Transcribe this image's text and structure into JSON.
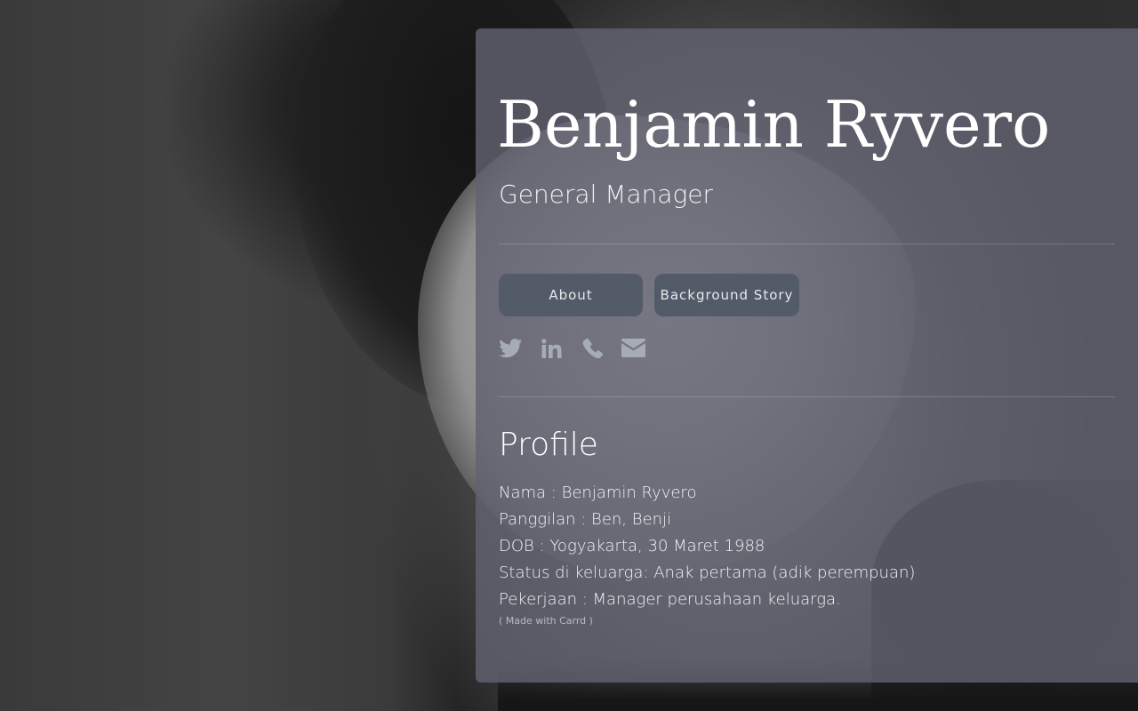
{
  "profile_card": {
    "name": "Benjamin Ryvero",
    "job_title": "General Manager",
    "buttons": {
      "about": "About",
      "background_story": "Background Story"
    },
    "social_icons": [
      "twitter-icon",
      "linkedin-icon",
      "phone-icon",
      "envelope-icon"
    ],
    "section_heading": "Profile",
    "details": [
      "Nama : Benjamin Ryvero",
      "Panggilan : Ben, Benji",
      "DOB : Yogyakarta, 30 Maret 1988",
      "Status di keluarga: Anak pertama (adik perempuan)",
      "Pekerjaan : Manager perusahaan keluarga."
    ],
    "footer_note": "( Made with Carrd )"
  },
  "colors": {
    "card_background": "#606270",
    "button_background": "#535a68",
    "icon_color": "#a6abb8",
    "text": "#ffffff"
  }
}
